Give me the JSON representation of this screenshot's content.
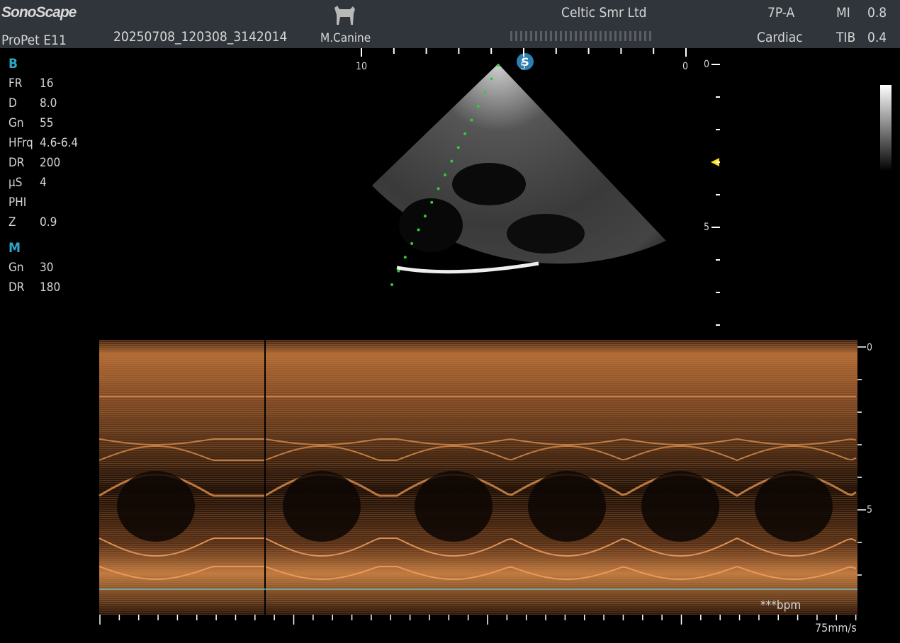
{
  "header": {
    "brand": "SonoScape",
    "model": "ProPet E11",
    "exam_id": "20250708_120308_3142014",
    "patient_type": "M.Canine",
    "institution": "Celtic Smr Ltd",
    "probe": "7P-A",
    "preset": "Cardiac",
    "mi_label": "MI",
    "mi_value": "0.8",
    "tib_label": "TIB",
    "tib_value": "0.4"
  },
  "b_mode": {
    "title": "B",
    "params": [
      {
        "k": "FR",
        "v": "16"
      },
      {
        "k": "D",
        "v": "8.0"
      },
      {
        "k": "Gn",
        "v": "55"
      },
      {
        "k": "HFrq",
        "v": "4.6-6.4"
      },
      {
        "k": "DR",
        "v": "200"
      },
      {
        "k": "µS",
        "v": "4"
      },
      {
        "k": "PHI",
        "v": ""
      },
      {
        "k": "Z",
        "v": "0.9"
      }
    ],
    "top_scale": [
      "10",
      "5",
      "0"
    ],
    "depth_scale": [
      "0",
      "5"
    ]
  },
  "m_mode": {
    "title": "M",
    "params": [
      {
        "k": "Gn",
        "v": "30"
      },
      {
        "k": "DR",
        "v": "180"
      }
    ],
    "depth_scale": [
      "0",
      "5"
    ],
    "heart_rate": "***bpm",
    "sweep_speed": "75mm/s"
  },
  "colors": {
    "header_bg": "#30353b",
    "accent": "#2aa7c9",
    "mmode": "#c8783a",
    "baseline": "#6fd0d8"
  }
}
